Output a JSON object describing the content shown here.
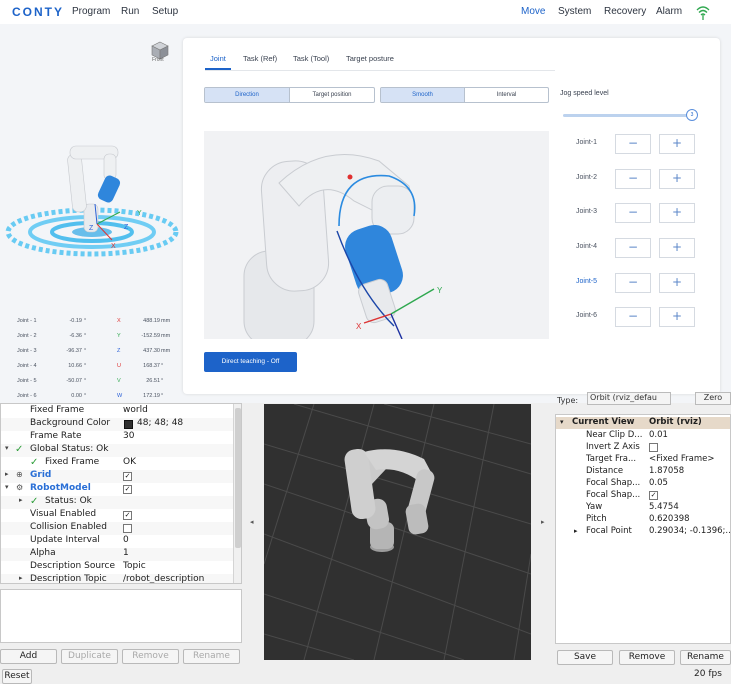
{
  "app": {
    "logo": "CONTY",
    "menu_left": [
      "Program",
      "Run",
      "Setup"
    ],
    "menu_right": [
      "Move",
      "System",
      "Recovery",
      "Alarm"
    ],
    "active_menu": "Move",
    "accent": "#1d63c9"
  },
  "left_view": {
    "cube_label": "Front",
    "joints": [
      {
        "name": "Joint - 1",
        "value": "-0.19",
        "unit": "°",
        "axis": "X",
        "axis_value": "488.19",
        "axis_unit": "mm"
      },
      {
        "name": "Joint - 2",
        "value": "-6.36",
        "unit": "°",
        "axis": "Y",
        "axis_value": "-152.59",
        "axis_unit": "mm"
      },
      {
        "name": "Joint - 3",
        "value": "-96.37",
        "unit": "°",
        "axis": "Z",
        "axis_value": "437.30",
        "axis_unit": "mm"
      },
      {
        "name": "Joint - 4",
        "value": "10.66",
        "unit": "°",
        "axis": "U",
        "axis_value": "168.37",
        "axis_unit": "°"
      },
      {
        "name": "Joint - 5",
        "value": "-50.07",
        "unit": "°",
        "axis": "V",
        "axis_value": "26.51",
        "axis_unit": "°"
      },
      {
        "name": "Joint - 6",
        "value": "0.00",
        "unit": "°",
        "axis": "W",
        "axis_value": "172.19",
        "axis_unit": "°"
      }
    ]
  },
  "move_panel": {
    "tabs": [
      "Joint",
      "Task (Ref)",
      "Task (Tool)",
      "Target posture"
    ],
    "active_tab": "Joint",
    "mode_toggle": [
      "Direction",
      "Target position"
    ],
    "motion_toggle": [
      "Smooth",
      "Interval"
    ],
    "jog_speed_label": "Jog speed level",
    "jog_speed_value": "3",
    "jog_speed_fraction": 1.0,
    "jog_joints": [
      "Joint-1",
      "Joint-2",
      "Joint-3",
      "Joint-4",
      "Joint-5",
      "Joint-6"
    ],
    "active_joint": "Joint-5",
    "minus": "−",
    "plus": "+",
    "direct_teaching": "Direct teaching - Off",
    "axis_labels": {
      "x": "X",
      "y": "Y",
      "z": "Z"
    }
  },
  "rviz": {
    "displays": [
      {
        "key": "Fixed Frame",
        "value": "world",
        "indent": 2
      },
      {
        "key": "Background Color",
        "value": "48; 48; 48",
        "indent": 2,
        "swatch": "#303030"
      },
      {
        "key": "Frame Rate",
        "value": "30",
        "indent": 2
      },
      {
        "key": "Global Status: Ok",
        "value": "",
        "indent": 0,
        "expander": "▾",
        "check": true
      },
      {
        "key": "Fixed Frame",
        "value": "OK",
        "indent": 2,
        "check": true
      },
      {
        "key": "Grid",
        "value": "",
        "indent": 0,
        "expander": "▸",
        "blue": true,
        "checkbox": true,
        "icon": "grid-icon"
      },
      {
        "key": "RobotModel",
        "value": "",
        "indent": 0,
        "expander": "▾",
        "blue": true,
        "checkbox": true,
        "icon": "robot-icon"
      },
      {
        "key": "Status: Ok",
        "value": "",
        "indent": 1,
        "expander": "▸",
        "check": true
      },
      {
        "key": "Visual Enabled",
        "value": "",
        "indent": 2,
        "checkbox": true
      },
      {
        "key": "Collision Enabled",
        "value": "",
        "indent": 2,
        "checkbox": false
      },
      {
        "key": "Update Interval",
        "value": "0",
        "indent": 2
      },
      {
        "key": "Alpha",
        "value": "1",
        "indent": 2
      },
      {
        "key": "Description Source",
        "value": "Topic",
        "indent": 2
      },
      {
        "key": "Description Topic",
        "value": "/robot_description",
        "indent": 1,
        "expander": "▸"
      }
    ],
    "display_buttons": [
      "Add",
      "Duplicate",
      "Remove",
      "Rename"
    ],
    "disabled_buttons": [
      "Duplicate",
      "Remove",
      "Rename"
    ],
    "reset": "Reset",
    "views_type_label": "Type:",
    "views_type_value": "Orbit (rviz_defau",
    "views_zero": "Zero",
    "views": [
      {
        "key": "Current View",
        "value": "Orbit (rviz)",
        "head": true,
        "expander": "▾"
      },
      {
        "key": "Near Clip D...",
        "value": "0.01"
      },
      {
        "key": "Invert Z Axis",
        "value": "",
        "checkbox": false
      },
      {
        "key": "Target Fra...",
        "value": "<Fixed Frame>"
      },
      {
        "key": "Distance",
        "value": "1.87058"
      },
      {
        "key": "Focal Shap...",
        "value": "0.05"
      },
      {
        "key": "Focal Shap...",
        "value": "",
        "checkbox": true
      },
      {
        "key": "Yaw",
        "value": "5.4754"
      },
      {
        "key": "Pitch",
        "value": "0.620398"
      },
      {
        "key": "Focal Point",
        "value": "0.29034; -0.1396;...",
        "expander": "▸"
      }
    ],
    "views_buttons": [
      "Save",
      "Remove",
      "Rename"
    ],
    "fps": "20 fps"
  }
}
